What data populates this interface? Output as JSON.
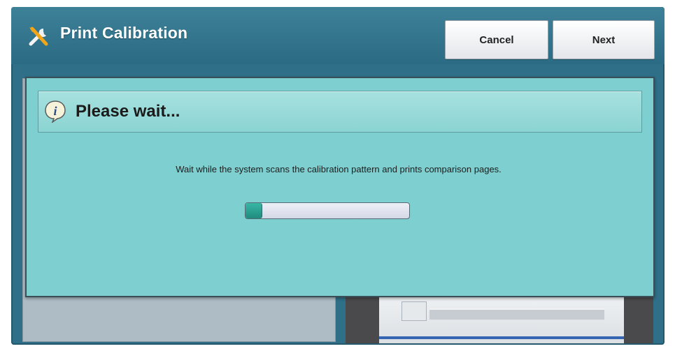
{
  "window": {
    "title": "Print Calibration",
    "title_icon": "tools-icon"
  },
  "buttons": {
    "cancel": "Cancel",
    "next": "Next"
  },
  "dialog": {
    "title": "Please wait...",
    "icon": "info-icon",
    "message": "Wait while the system scans the calibration pattern and prints comparison pages.",
    "progress": 0.1
  },
  "colors": {
    "header": "#2f6f88",
    "dialog_bg": "#7ecfd0",
    "progress_fill": "#2aa597"
  }
}
